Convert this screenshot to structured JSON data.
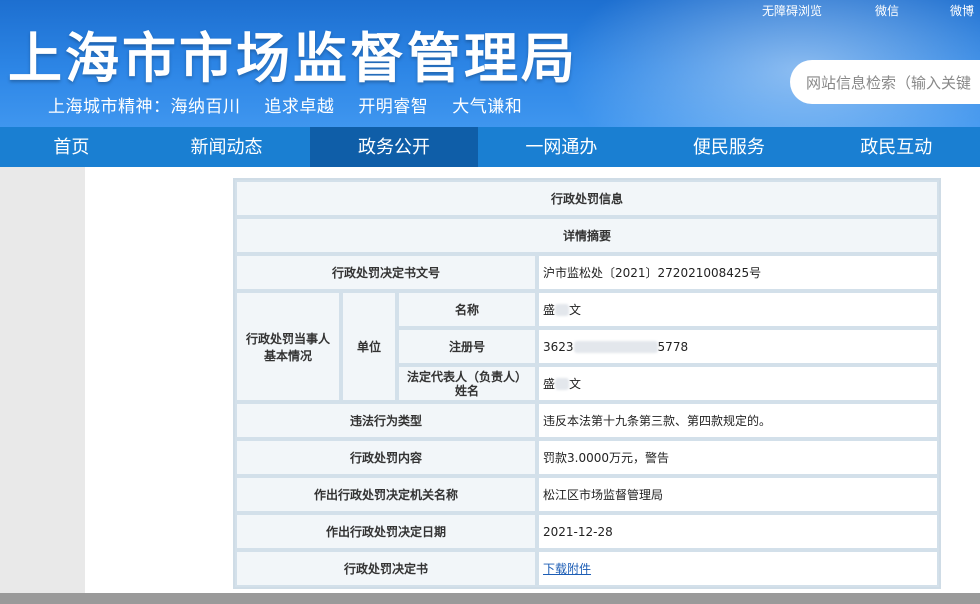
{
  "header": {
    "site_title": "上海市市场监督管理局",
    "slogan": [
      "上海城市精神：海纳百川",
      "追求卓越",
      "开明睿智",
      "大气谦和"
    ],
    "top_links": [
      "无障碍浏览",
      "微信",
      "微博"
    ],
    "search_placeholder": "网站信息检索（输入关键"
  },
  "nav": {
    "items": [
      "首页",
      "新闻动态",
      "政务公开",
      "一网通办",
      "便民服务",
      "政民互动"
    ],
    "active": "政务公开"
  },
  "table": {
    "title": "行政处罚信息",
    "subtitle": "详情摘要",
    "doc_no_label": "行政处罚决定书文号",
    "doc_no_value": "沪市监松处〔2021〕272021008425号",
    "party_label": "行政处罚当事人基本情况",
    "unit_label": "单位",
    "name_label": "名称",
    "name_value_start": "盛",
    "name_value_end": "文",
    "reg_label": "注册号",
    "reg_value_start": "3623",
    "reg_value_end": "5778",
    "rep_label": "法定代表人（负责人）姓名",
    "rep_value_start": "盛",
    "rep_value_end": "文",
    "violation_label": "违法行为类型",
    "violation_value": "违反本法第十九条第三款、第四款规定的。",
    "content_label": "行政处罚内容",
    "content_value": "罚款3.0000万元，警告",
    "authority_label": "作出行政处罚决定机关名称",
    "authority_value": "松江区市场监督管理局",
    "date_label": "作出行政处罚决定日期",
    "date_value": "2021-12-28",
    "decision_label": "行政处罚决定书",
    "download_label": "下载附件"
  }
}
